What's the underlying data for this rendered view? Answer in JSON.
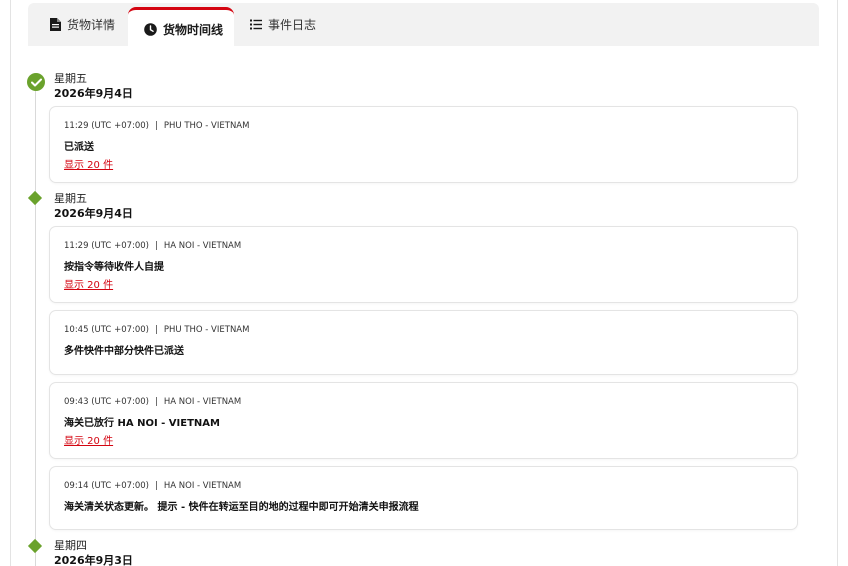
{
  "tabs": [
    {
      "label": "货物详情",
      "icon": "document-icon"
    },
    {
      "label": "货物时间线",
      "icon": "clock-icon",
      "active": true
    },
    {
      "label": "事件日志",
      "icon": "list-icon"
    }
  ],
  "colors": {
    "accent": "#d40511",
    "success": "#6aa22c"
  },
  "timeline": {
    "groups": [
      {
        "weekday": "星期五",
        "date": "2026年9月4日",
        "marker": "check",
        "events": [
          {
            "time": "11:29 (UTC +07:00)",
            "location": "PHU THO - VIETNAM",
            "status": "已派送",
            "link": "显示 20 件"
          }
        ]
      },
      {
        "weekday": "星期五",
        "date": "2026年9月4日",
        "marker": "diamond",
        "events": [
          {
            "time": "11:29 (UTC +07:00)",
            "location": "HA NOI - VIETNAM",
            "status": "按指令等待收件人自提",
            "link": "显示 20 件"
          },
          {
            "time": "10:45 (UTC +07:00)",
            "location": "PHU THO - VIETNAM",
            "status": "多件快件中部分快件已派送"
          },
          {
            "time": "09:43 (UTC +07:00)",
            "location": "HA NOI - VIETNAM",
            "status": "海关已放行 HA NOI - VIETNAM",
            "link": "显示 20 件"
          },
          {
            "time": "09:14 (UTC +07:00)",
            "location": "HA NOI - VIETNAM",
            "status": "海关清关状态更新。 提示 - 快件在转运至目的地的过程中即可开始清关申报流程"
          }
        ]
      },
      {
        "weekday": "星期四",
        "date": "2026年9月3日",
        "marker": "diamond",
        "events": []
      }
    ]
  }
}
